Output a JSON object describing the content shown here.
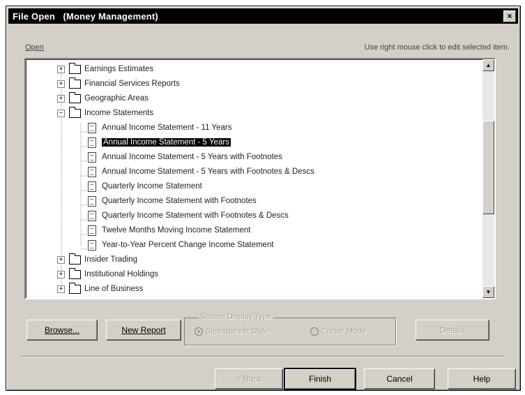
{
  "window": {
    "title": "File Open   (Money Management)",
    "close_glyph": "×"
  },
  "open_label": "Open",
  "hint": "Use right mouse click to edit selected item.",
  "tree": {
    "items": [
      {
        "label": "Earnings Estimates",
        "type": "folder",
        "expander": "+"
      },
      {
        "label": "Financial Services Reports",
        "type": "folder",
        "expander": "+"
      },
      {
        "label": "Geographic Areas",
        "type": "folder",
        "expander": "+"
      },
      {
        "label": "Income Statements",
        "type": "folder",
        "expander": "−"
      },
      {
        "label": "Annual Income Statement - 11 Years",
        "type": "document"
      },
      {
        "label": "Annual Income Statement - 5 Years",
        "type": "document",
        "selected": true
      },
      {
        "label": "Annual Income Statement - 5 Years with Footnotes",
        "type": "document"
      },
      {
        "label": "Annual Income Statement - 5 Years with Footnotes & Descs",
        "type": "document"
      },
      {
        "label": "Quarterly Income Statement",
        "type": "document"
      },
      {
        "label": "Quarterly Income Statement with Footnotes",
        "type": "document"
      },
      {
        "label": "Quarterly Income Statement with Footnotes & Descs",
        "type": "document"
      },
      {
        "label": "Twelve Months Moving Income Statement",
        "type": "document"
      },
      {
        "label": "Year-to-Year Percent Change Income Statement",
        "type": "document"
      },
      {
        "label": "Insider Trading",
        "type": "folder",
        "expander": "+"
      },
      {
        "label": "Institutional Holdings",
        "type": "folder",
        "expander": "+"
      },
      {
        "label": "Line of Business",
        "type": "folder",
        "expander": "+"
      }
    ]
  },
  "scrollbar": {
    "up": "▲",
    "down": "▼"
  },
  "buttons": {
    "browse": "Browse...",
    "new_report": "New Report",
    "details": "Details",
    "back": "< Back",
    "finish": "Finish",
    "cancel": "Cancel",
    "help": "Help"
  },
  "screen_display": {
    "legend": "Screen Display Type",
    "options": [
      {
        "label": "Spreadsheet Style",
        "selected": true
      },
      {
        "label": "Cursor Mode",
        "selected": false
      }
    ]
  }
}
